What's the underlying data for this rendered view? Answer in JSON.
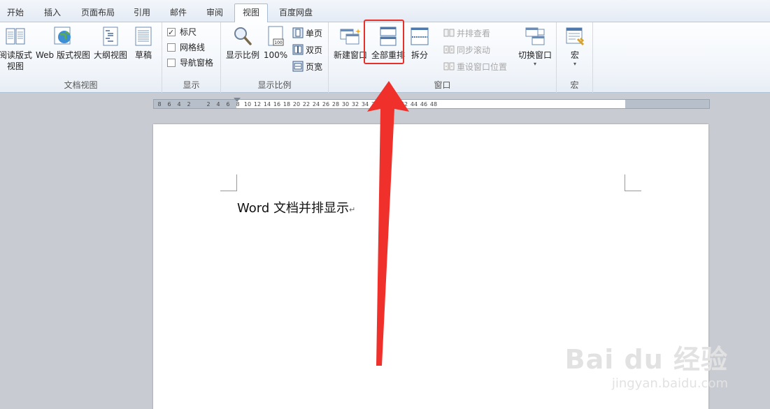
{
  "tabs": [
    "开始",
    "插入",
    "页面布局",
    "引用",
    "邮件",
    "审阅",
    "视图",
    "百度网盘"
  ],
  "active_tab": "视图",
  "groups": {
    "doc_views": {
      "label": "文档视图",
      "reading": "阅读版式\n视图",
      "web": "Web 版式视图",
      "outline": "大纲视图",
      "draft": "草稿"
    },
    "show": {
      "label": "显示",
      "ruler": "标尺",
      "gridlines": "网格线",
      "nav_pane": "导航窗格",
      "ruler_checked": true,
      "gridlines_checked": false,
      "nav_pane_checked": false
    },
    "zoom": {
      "label": "显示比例",
      "zoom": "显示比例",
      "hundred": "100%",
      "one_page": "单页",
      "two_pages": "双页",
      "page_width": "页宽"
    },
    "window": {
      "label": "窗口",
      "new_window": "新建窗口",
      "arrange_all": "全部重排",
      "split": "拆分",
      "side_by_side": "并排查看",
      "sync_scroll": "同步滚动",
      "reset_pos": "重设窗口位置",
      "switch_windows": "切换窗口"
    },
    "macros": {
      "label": "宏",
      "macros": "宏"
    }
  },
  "ruler_ticks": [
    "8",
    "6",
    "4",
    "2",
    "2",
    "4",
    "6",
    "8",
    "10",
    "12",
    "14",
    "16",
    "18",
    "20",
    "22",
    "24",
    "26",
    "28",
    "30",
    "32",
    "34",
    "36",
    "38",
    "40",
    "42",
    "44",
    "46",
    "48"
  ],
  "document": {
    "text": "Word 文档并排显示",
    "para_mark": "↵"
  },
  "watermark": {
    "logo": "Bai du 经验",
    "url": "jingyan.baidu.com"
  },
  "colors": {
    "highlight": "#e8302a",
    "arrow": "#f0302a"
  }
}
